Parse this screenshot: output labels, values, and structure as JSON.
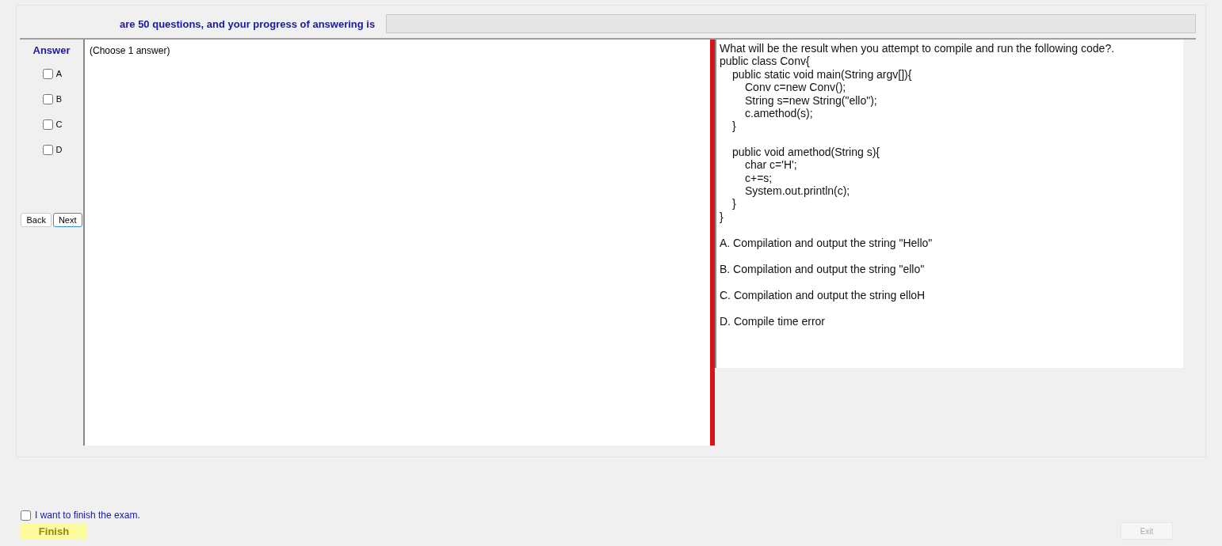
{
  "header": {
    "text": "are 50 questions, and your progress of answering is",
    "progress": {
      "level": 0
    }
  },
  "answer_panel": {
    "title": "Answer",
    "options": [
      {
        "label": "A",
        "checked": false
      },
      {
        "label": "B",
        "checked": false
      },
      {
        "label": "C",
        "checked": false
      },
      {
        "label": "D",
        "checked": false
      }
    ],
    "buttons": [
      {
        "label": "Back",
        "selected": false
      },
      {
        "label": "Next",
        "selected": true
      }
    ]
  },
  "answer_area": {
    "text": "(Choose 1 answer)"
  },
  "question": {
    "prompt": "What will be the result when you attempt to compile and run the following code?.",
    "code": [
      {
        "text": "public class Conv{",
        "children": [
          {
            "text": "public static void main(String argv[]){",
            "children": [
              {
                "text": "Conv c=new Conv();"
              },
              {
                "text": "String s=new String(\"ello\");"
              },
              {
                "text": "c.amethod(s);"
              }
            ]
          },
          {
            "text": "}"
          },
          {
            "text": "public void amethod(String s){",
            "children": [
              {
                "text": "char c='H';"
              },
              {
                "text": "c+=s;"
              },
              {
                "text": "System.out.println(c);"
              }
            ]
          },
          {
            "text": "}"
          }
        ]
      },
      {
        "text": "}"
      }
    ],
    "choices": [
      "A.  Compilation and output the string \"Hello\"",
      "B.  Compilation and output the string \"ello\"",
      "C.  Compilation and output the string elloH",
      "D.  Compile time error"
    ]
  },
  "finish": {
    "label": "I want to finish the exam.",
    "checked": false,
    "button": "Finish"
  },
  "exit": {
    "label": "Exit",
    "disabled": true
  }
}
